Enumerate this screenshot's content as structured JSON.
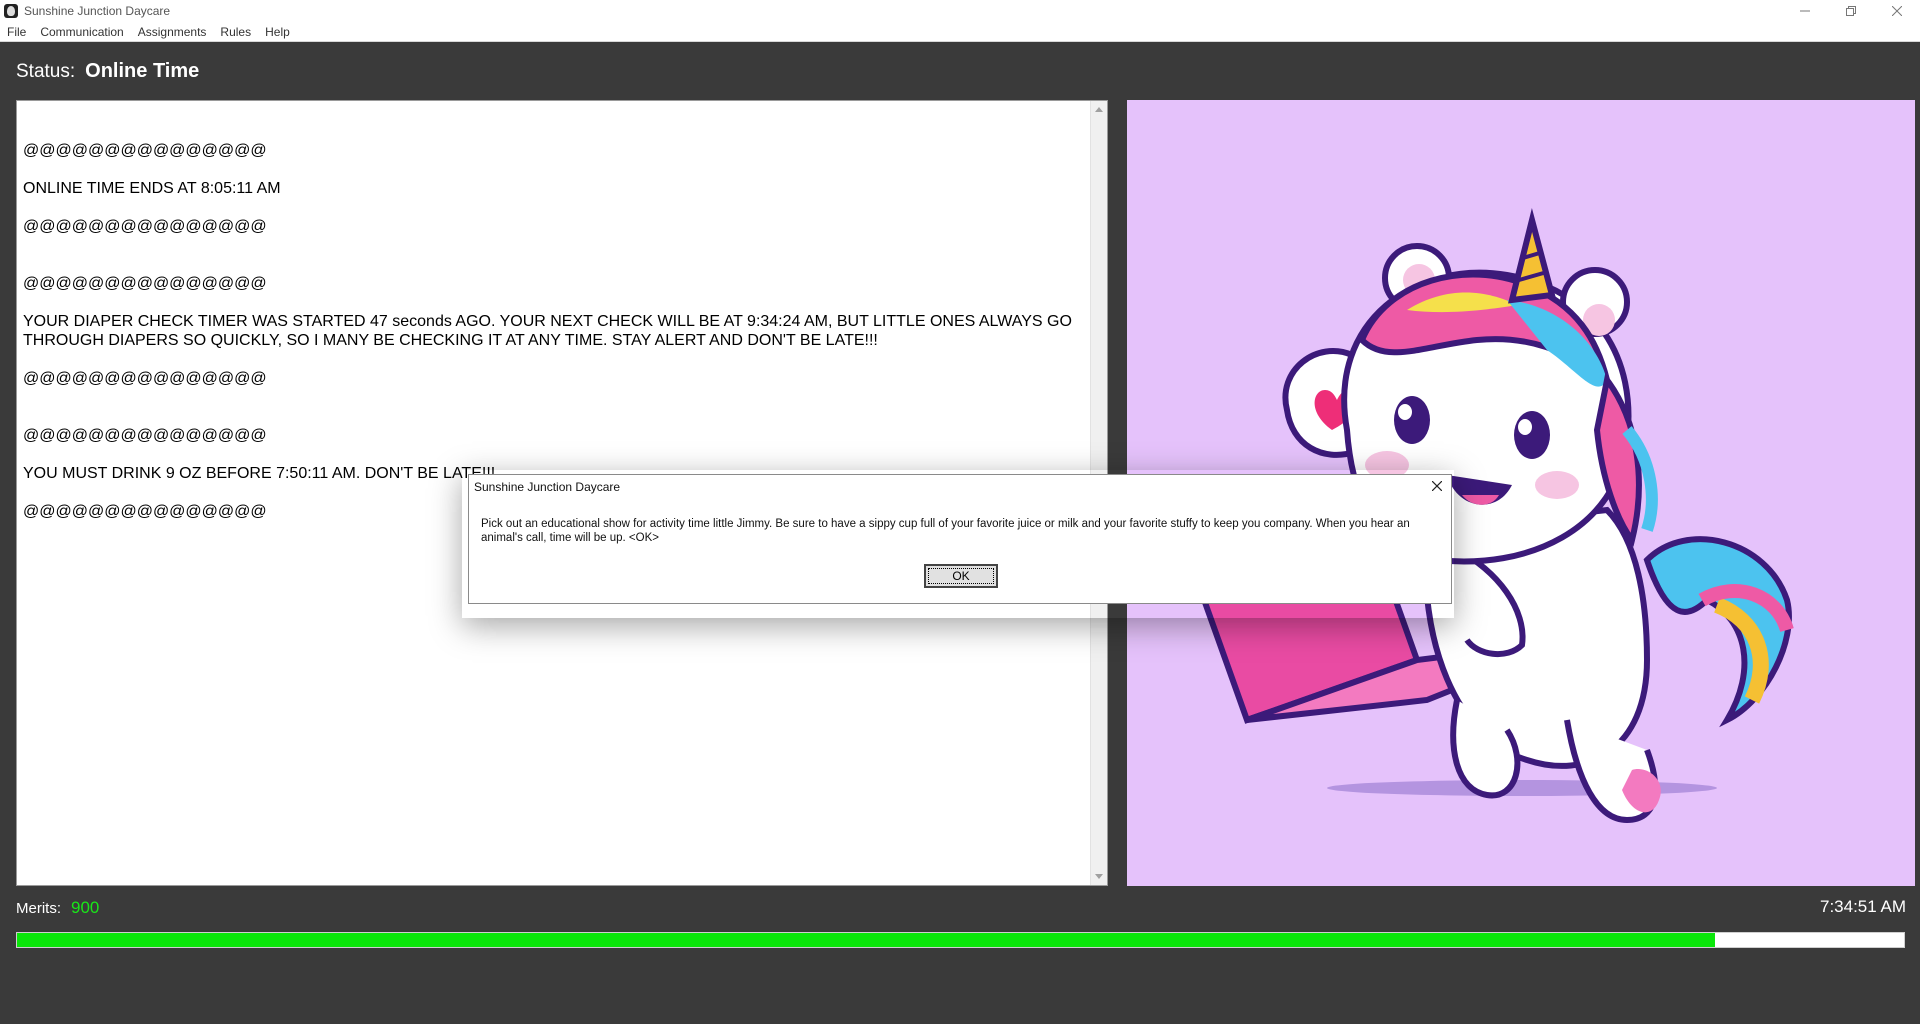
{
  "window": {
    "title": "Sunshine Junction Daycare",
    "icon": "app-silhouette-icon"
  },
  "menu": {
    "items": [
      "File",
      "Communication",
      "Assignments",
      "Rules",
      "Help"
    ]
  },
  "status": {
    "label": "Status:",
    "value": "Online Time"
  },
  "messages": {
    "lines": [
      "@@@@@@@@@@@@@@@",
      "",
      "ONLINE TIME ENDS AT 8:05:11 AM",
      "",
      "@@@@@@@@@@@@@@@",
      "",
      "",
      "@@@@@@@@@@@@@@@",
      "",
      "YOUR DIAPER CHECK TIMER WAS STARTED 47 seconds AGO. YOUR NEXT CHECK WILL BE AT 9:34:24 AM, BUT LITTLE ONES ALWAYS GO THROUGH DIAPERS SO QUICKLY, SO I MANY BE CHECKING IT AT ANY TIME. STAY ALERT AND DON'T BE LATE!!!",
      "",
      "@@@@@@@@@@@@@@@",
      "",
      "",
      "@@@@@@@@@@@@@@@",
      "",
      "YOU MUST DRINK 9 OZ BEFORE 7:50:11 AM. DON'T BE LATE!!!",
      "",
      "@@@@@@@@@@@@@@@"
    ]
  },
  "image": {
    "description_icon": "unicorn-with-laptop-illustration",
    "background": "#e5c2fb"
  },
  "merits": {
    "label": "Merits:",
    "value": "900"
  },
  "clock": "7:34:51 AM",
  "progress": {
    "fraction": 0.9
  },
  "dialog": {
    "title": "Sunshine Junction Daycare",
    "message": "Pick out an educational show for activity time little Jimmy. Be sure to have a sippy cup full of your favorite juice or milk and your favorite stuffy to keep you company. When you hear an animal's call, time will be up. <OK>",
    "ok_label": "OK"
  },
  "colors": {
    "background": "#3a3a3a",
    "merits": "#19e619",
    "progress": "#0ae60a"
  }
}
